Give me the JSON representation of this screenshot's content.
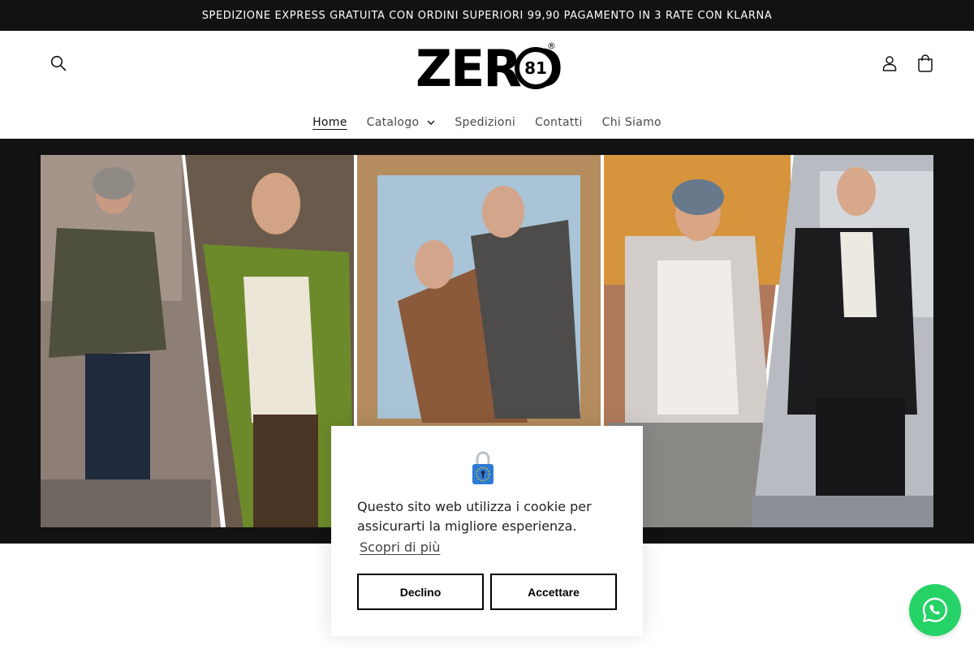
{
  "announcement": {
    "text": "SPEDIZIONE EXPRESS GRATUITA CON ORDINI SUPERIORI 99,90 PAGAMENTO IN 3 RATE CON KLARNA"
  },
  "header": {
    "logo_text": "ZERO",
    "logo_number": "81",
    "logo_mark": "®",
    "icons": {
      "search": "search-icon",
      "account": "user-icon",
      "cart": "bag-icon"
    }
  },
  "nav": {
    "items": [
      {
        "label": "Home",
        "active": true
      },
      {
        "label": "Catalogo",
        "has_dropdown": true
      },
      {
        "label": "Spedizioni"
      },
      {
        "label": "Contatti"
      },
      {
        "label": "Chi Siamo"
      }
    ]
  },
  "banner": {
    "image": "fashion-collage-photo"
  },
  "cookie_banner": {
    "icon": "eu-lock-icon",
    "message": "Questo sito web utilizza i cookie per assicurarti la migliore esperienza.",
    "learn_more": "Scopri di più",
    "decline_label": "Declino",
    "accept_label": "Accettare"
  },
  "whatsapp": {
    "icon": "whatsapp-icon",
    "color": "#25d366"
  },
  "colors": {
    "dark": "#121212",
    "text": "#121212",
    "muted": "#4a4a4a"
  }
}
